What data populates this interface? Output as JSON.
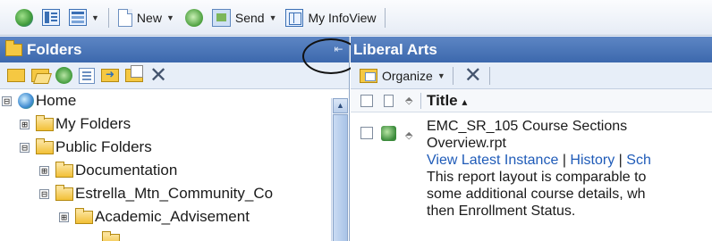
{
  "toolbar": {
    "new_label": "New",
    "send_label": "Send",
    "infoview_label": "My InfoView"
  },
  "left_pane": {
    "title": "Folders",
    "collapse_glyph": "⇤",
    "tree": [
      {
        "label": "Home",
        "toggle": "⊟",
        "icon": "home-icon"
      },
      {
        "label": "My Folders",
        "toggle": "⊞",
        "icon": "folder-icon"
      },
      {
        "label": "Public Folders",
        "toggle": "⊟",
        "icon": "folder-icon"
      },
      {
        "label": "Documentation",
        "toggle": "⊞",
        "icon": "folder-icon"
      },
      {
        "label": "Estrella_Mtn_Community_Co",
        "toggle": "⊟",
        "icon": "folder-icon"
      },
      {
        "label": "Academic_Advisement",
        "toggle": "⊞",
        "icon": "folder-icon"
      }
    ]
  },
  "right_pane": {
    "title": "Liberal Arts",
    "organize_label": "Organize",
    "column_title": "Title",
    "sort_indicator": "▴",
    "item": {
      "title_line1": "EMC_SR_105 Course Sections",
      "title_line2": "Overview.rpt",
      "link_latest": "View Latest Instance",
      "link_history": "History",
      "link_sch": "Sch",
      "desc_line1": "This report layout is comparable to",
      "desc_line2": "some additional course details, wh",
      "desc_line3": "then Enrollment Status."
    }
  },
  "colors": {
    "header_blue": "#4a75b8",
    "link_blue": "#1f5bb8",
    "folder_yellow": "#f5c842"
  }
}
